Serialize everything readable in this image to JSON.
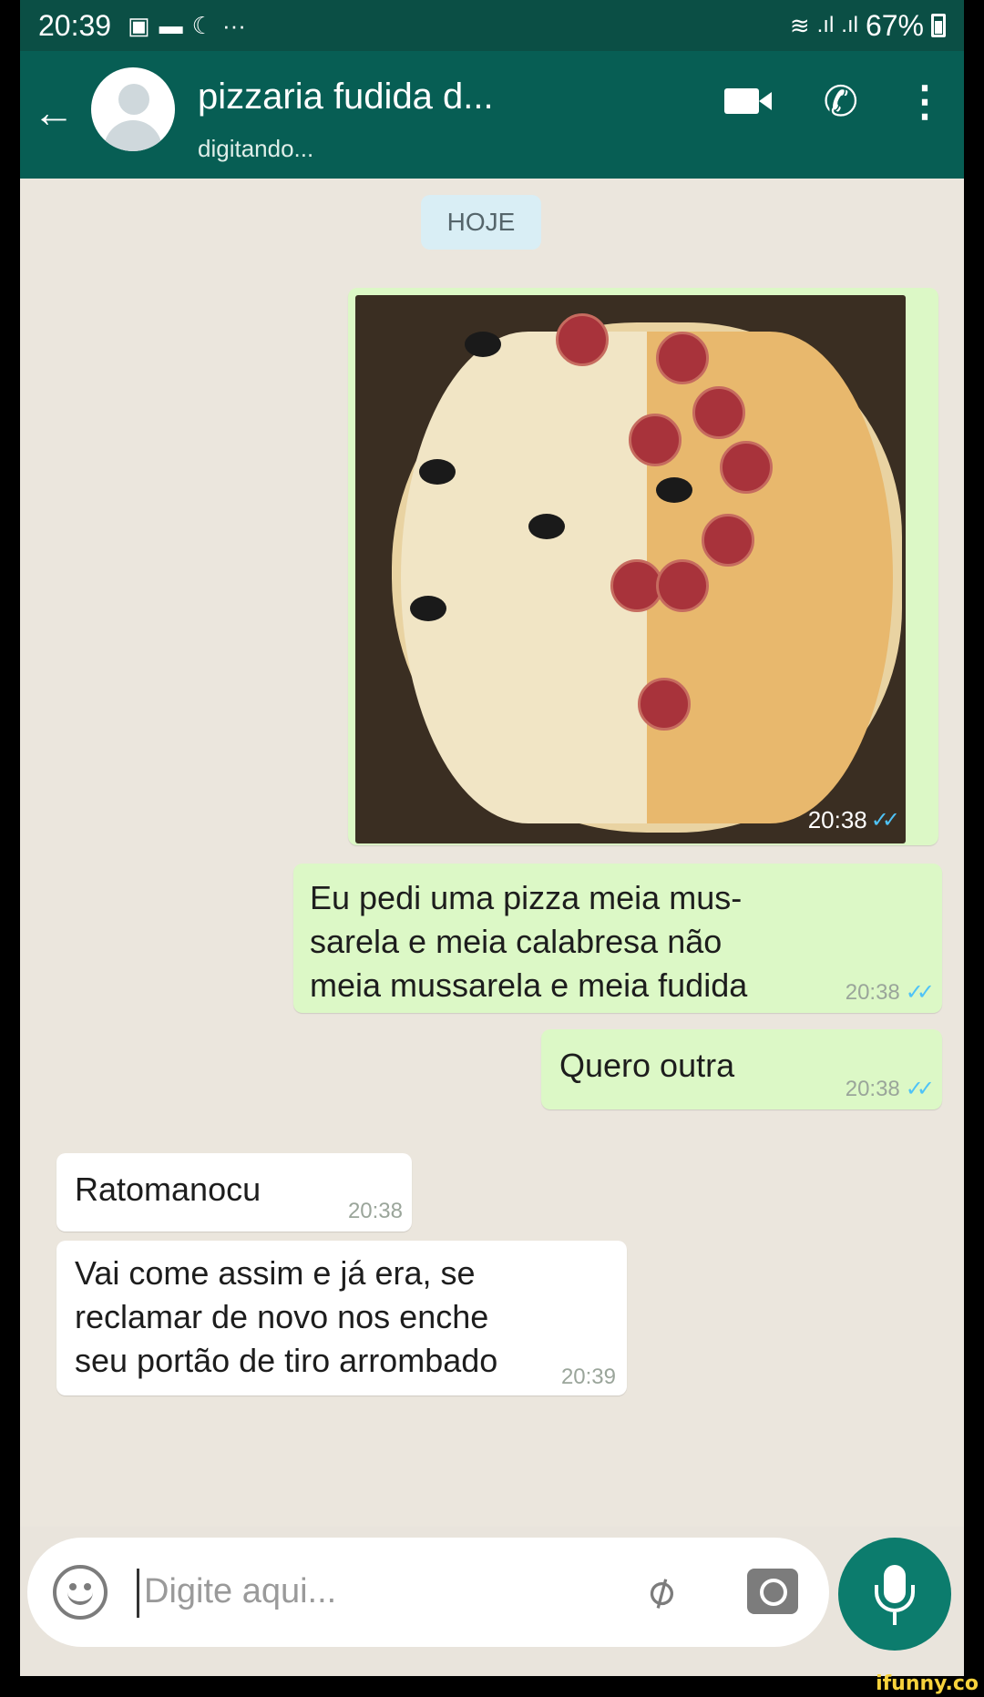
{
  "status_bar": {
    "time": "20:39",
    "battery": "67%",
    "icons": [
      "notification-icon",
      "message-icon",
      "moon-icon",
      "more-icon",
      "wifi-icon",
      "signal-icon",
      "signal-icon",
      "battery-icon"
    ]
  },
  "header": {
    "contact_name": "pizzaria fudida d...",
    "status": "digitando..."
  },
  "chat": {
    "date_chip": "HOJE",
    "messages": [
      {
        "direction": "out",
        "type": "image",
        "time": "20:38",
        "read": true
      },
      {
        "direction": "out",
        "type": "text",
        "text": "Eu pedi uma pizza meia mus- sarela e meia calabresa não meia mussarela e meia fudida",
        "lines": [
          "Eu pedi uma pizza meia mus-",
          "sarela e meia calabresa não",
          "meia mussarela e meia fudida"
        ],
        "time": "20:38",
        "read": true
      },
      {
        "direction": "out",
        "type": "text",
        "text": "Quero outra",
        "time": "20:38",
        "read": true
      },
      {
        "direction": "in",
        "type": "text",
        "text": "Ratomanocu",
        "time": "20:38"
      },
      {
        "direction": "in",
        "type": "text",
        "text": "Vai come assim e já era, se reclamar de novo nos enche seu portão de tiro arrombado",
        "lines": [
          "Vai come assim e já era, se",
          "reclamar de novo nos enche",
          "seu portão de tiro arrombado"
        ],
        "time": "20:39"
      }
    ]
  },
  "input": {
    "placeholder": "Digite aqui..."
  },
  "colors": {
    "header_bg": "#075e54",
    "status_bg": "#0b4f45",
    "outgoing_bubble": "#dcf8c6",
    "incoming_bubble": "#ffffff",
    "read_ticks": "#4fc3f7",
    "mic_button": "#0c7c6d"
  },
  "watermark": "ifunny.co"
}
